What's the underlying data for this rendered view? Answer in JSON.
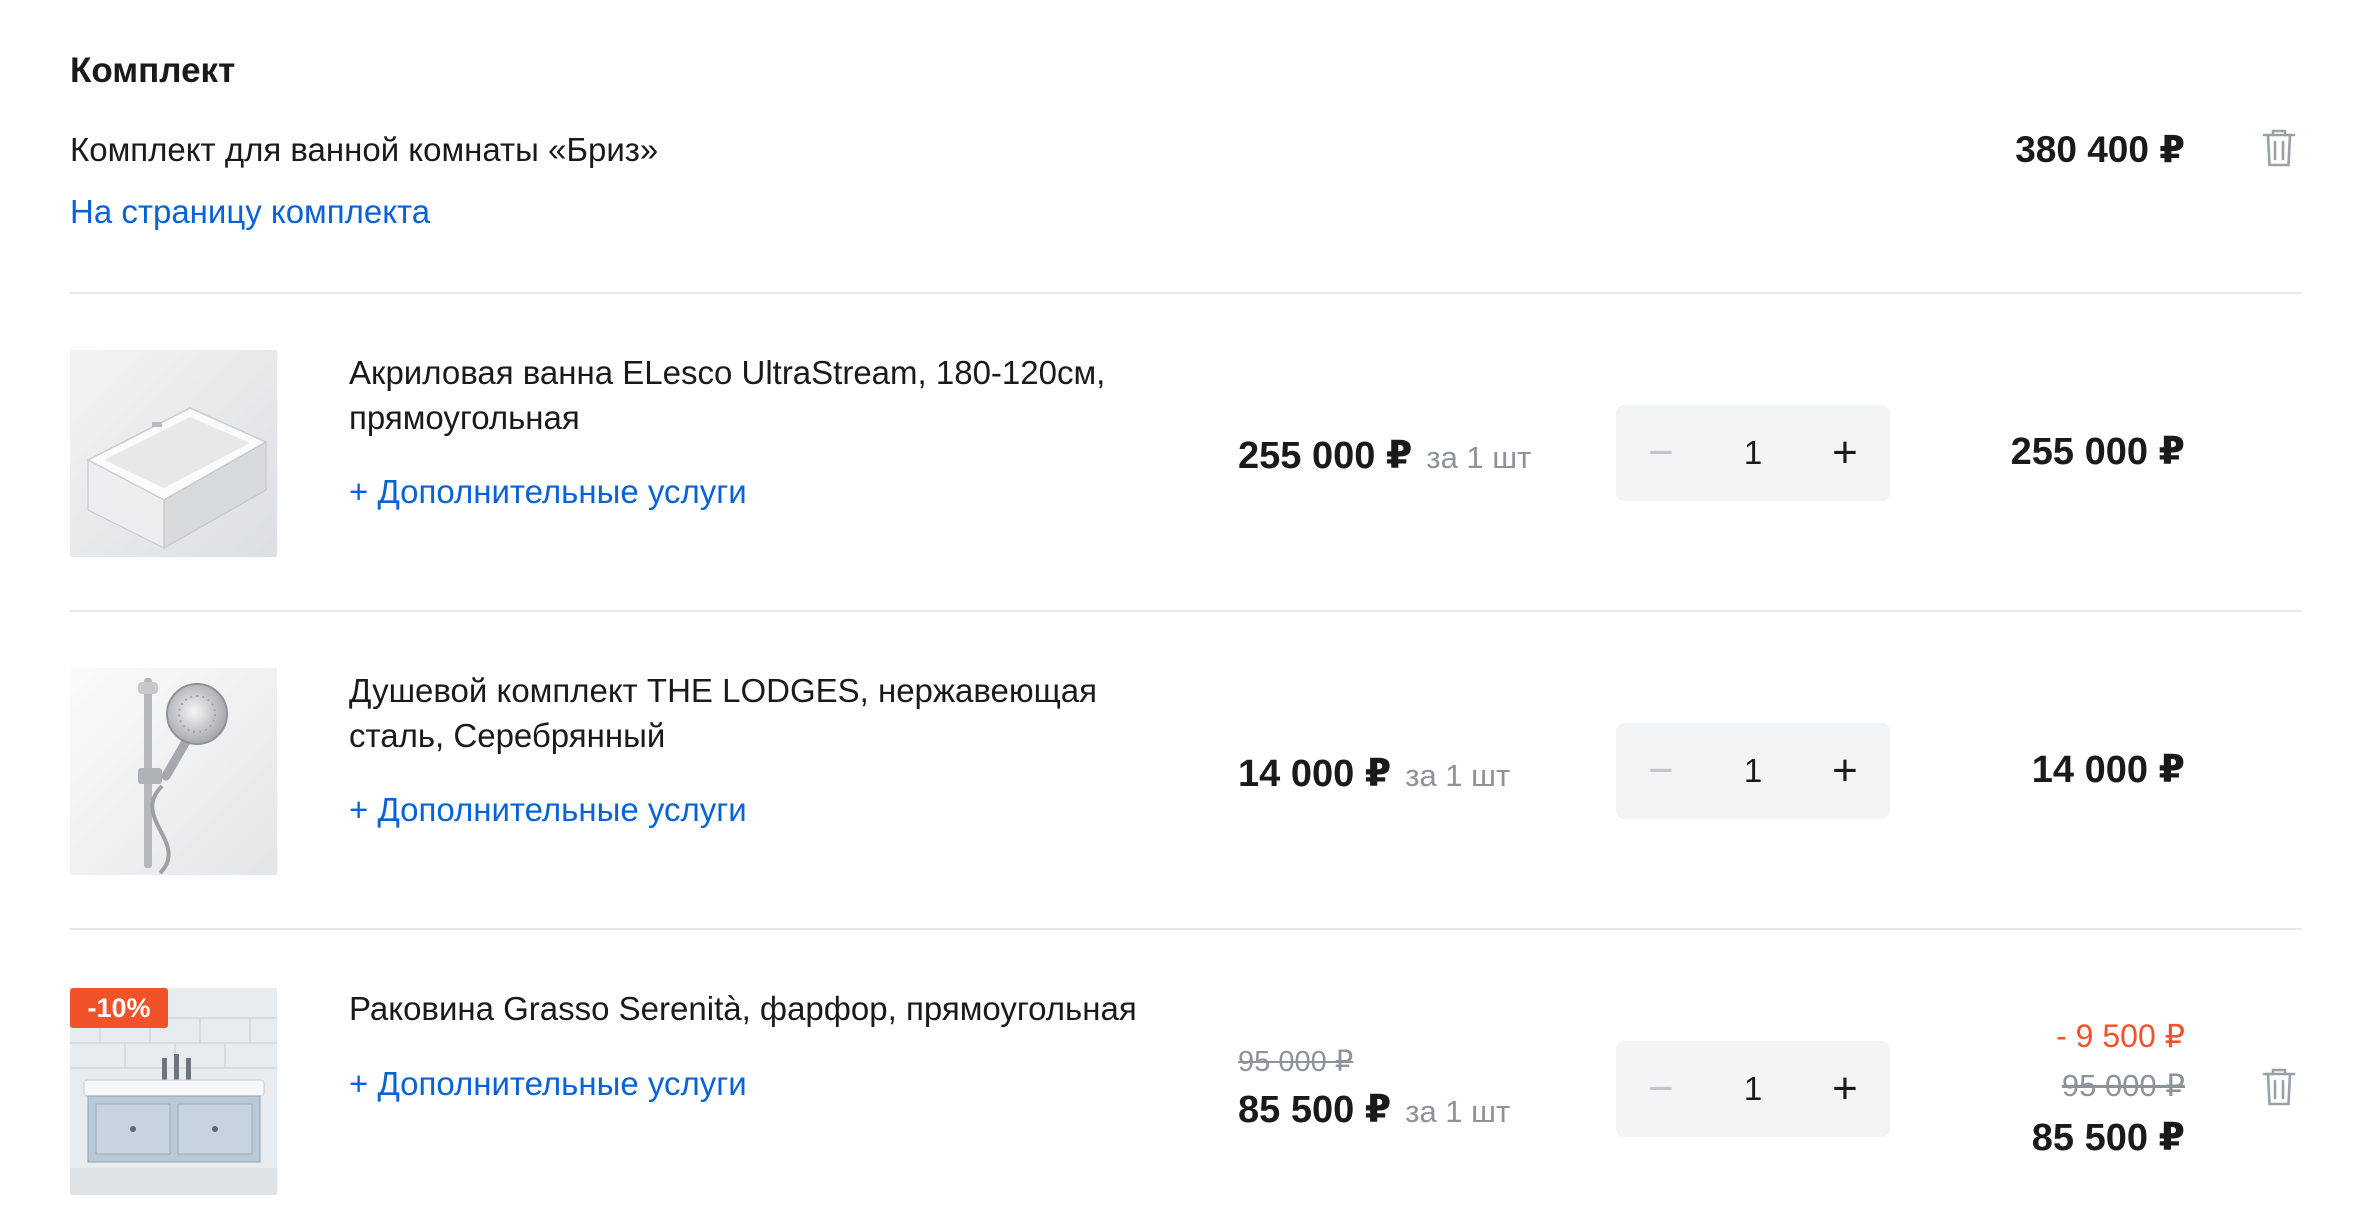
{
  "set": {
    "heading": "Комплект",
    "name": "Комплект для ванной комнаты «Бриз»",
    "link_label": "На страницу комплекта",
    "total": "380 400 ₽"
  },
  "items": [
    {
      "title": "Акриловая ванна ELesco UltraStream, 180-120см, прямоугольная",
      "services": "+ Дополнительные услуги",
      "price": "255 000 ₽",
      "per_unit": "за 1 шт",
      "quantity": "1",
      "total": "255 000 ₽",
      "image_icon": "bathtub-image"
    },
    {
      "title": "Душевой комплект THE LODGES, нержавеющая сталь, Серебрянный",
      "services": "+ Дополнительные услуги",
      "price": "14 000 ₽",
      "per_unit": "за 1 шт",
      "quantity": "1",
      "total": "14 000 ₽",
      "image_icon": "shower-set-image"
    },
    {
      "title": "Раковина Grasso Serenità, фарфор, прямоугольная",
      "services": "+ Дополнительные услуги",
      "old_price": "95 000 ₽",
      "price": "85 500 ₽",
      "per_unit": "за 1 шт",
      "quantity": "1",
      "discount_badge": "-10%",
      "discount_amount": "- 9 500 ₽",
      "old_total": "95 000 ₽",
      "total": "85 500 ₽",
      "image_icon": "sink-vanity-image"
    }
  ],
  "stepper": {
    "minus_symbol": "−",
    "plus_symbol": "+"
  },
  "colors": {
    "link": "#0a63d6",
    "discount": "#f0522a",
    "muted": "#8e929b",
    "stepper_bg": "#f3f4f6"
  }
}
